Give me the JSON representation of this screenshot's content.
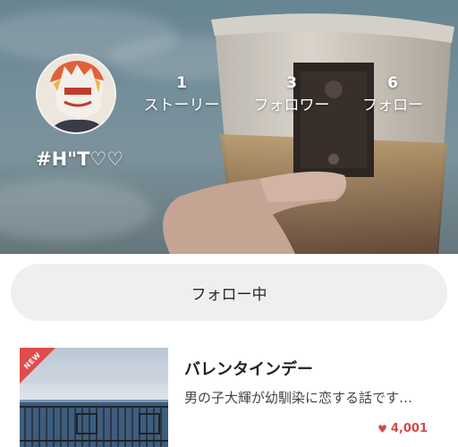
{
  "profile": {
    "username": "#H\"T♡♡",
    "stats": [
      {
        "count": "1",
        "label": "ストーリー"
      },
      {
        "count": "3",
        "label": "フォロワー"
      },
      {
        "count": "6",
        "label": "フォロー"
      }
    ]
  },
  "follow_button": {
    "label": "フォロー中"
  },
  "stories": [
    {
      "badge": "NEW",
      "title": "バレンタインデー",
      "description": "男の子大輝が幼馴染に恋する話です…",
      "likes": "4,001"
    }
  ],
  "colors": {
    "accent": "#d64848",
    "button_bg": "#eeefef"
  }
}
